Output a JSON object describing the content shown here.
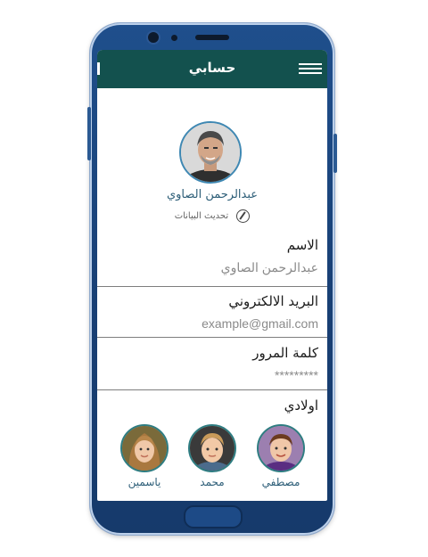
{
  "header": {
    "title": "حسابي"
  },
  "profile": {
    "name": "عبدالرحمن الصاوي",
    "update_label": "تحديث البيانات"
  },
  "fields": [
    {
      "label": "الاسم",
      "value": "عبدالرحمن الصاوي"
    },
    {
      "label": "البريد الالكتروني",
      "value": "example@gmail.com"
    },
    {
      "label": "كلمة المرور",
      "value": "*********"
    }
  ],
  "children": {
    "title": "اولادي",
    "items": [
      {
        "name": "مصطفي"
      },
      {
        "name": "محمد"
      },
      {
        "name": "ياسمين"
      }
    ]
  },
  "colors": {
    "header_bg": "#13514e",
    "phone_body": "#1f4f8c",
    "name_text": "#2d5e78"
  },
  "icons": [
    "hamburger-menu-icon",
    "edit-pencil-icon"
  ]
}
